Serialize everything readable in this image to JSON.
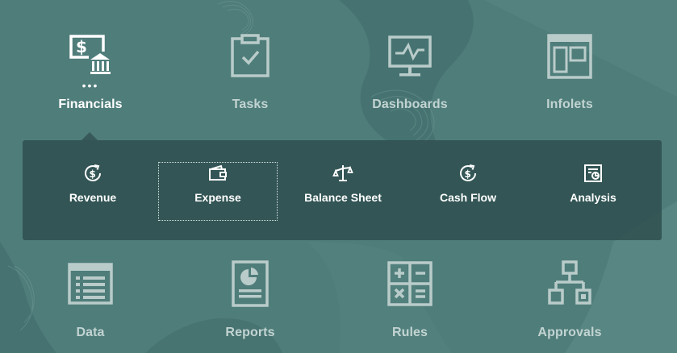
{
  "nav": {
    "financials": {
      "label": "Financials",
      "more": "•••",
      "icon": "money-bank-icon"
    },
    "tasks": {
      "label": "Tasks",
      "icon": "clipboard-check-icon"
    },
    "dashboards": {
      "label": "Dashboards",
      "icon": "monitor-chart-icon"
    },
    "infolets": {
      "label": "Infolets",
      "icon": "layout-panel-icon"
    },
    "data": {
      "label": "Data",
      "icon": "data-grid-icon"
    },
    "reports": {
      "label": "Reports",
      "icon": "report-pie-icon"
    },
    "rules": {
      "label": "Rules",
      "icon": "calculator-icon"
    },
    "approvals": {
      "label": "Approvals",
      "icon": "hierarchy-icon"
    }
  },
  "financials_submenu": {
    "items": [
      {
        "label": "Revenue",
        "icon": "dollar-refresh-icon"
      },
      {
        "label": "Expense",
        "icon": "wallet-icon"
      },
      {
        "label": "Balance Sheet",
        "icon": "scales-icon"
      },
      {
        "label": "Cash Flow",
        "icon": "dollar-refresh-icon"
      },
      {
        "label": "Analysis",
        "icon": "report-chart-icon"
      }
    ]
  },
  "colors": {
    "background": "#4f7d7a",
    "panel": "#2c4a4a",
    "active_label": "#ffffff",
    "inactive_label": "#c2d4d2",
    "inactive_icon": "#b9ccca"
  }
}
